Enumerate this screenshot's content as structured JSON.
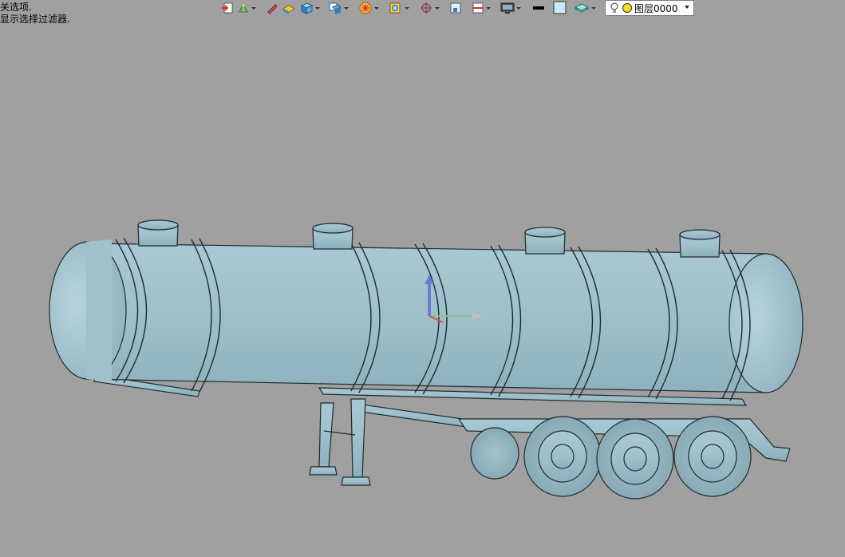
{
  "status": {
    "line1": "关选项.",
    "line2": "显示选择过滤器."
  },
  "toolbar": {
    "buttons": [
      {
        "name": "exit-sketch-icon"
      },
      {
        "name": "sketch-dropdown-icon"
      },
      {
        "name": "pencil-icon"
      },
      {
        "name": "extrude-icon"
      },
      {
        "name": "solid-view-icon"
      },
      {
        "name": "view-orientation-icon"
      },
      {
        "name": "display-style-icon"
      },
      {
        "name": "hide-show-icon"
      },
      {
        "name": "zoom-icon"
      },
      {
        "name": "rotate-view-icon"
      },
      {
        "name": "section-view-icon"
      },
      {
        "name": "monitor-icon"
      }
    ],
    "line_color": "#000000",
    "fill_color": "#cfe8f7",
    "layer": {
      "label": "图层0000"
    }
  },
  "model": {
    "name": "tank-trailer",
    "body_color": "#9ec0cc",
    "outline_color": "#1e2a2e"
  }
}
